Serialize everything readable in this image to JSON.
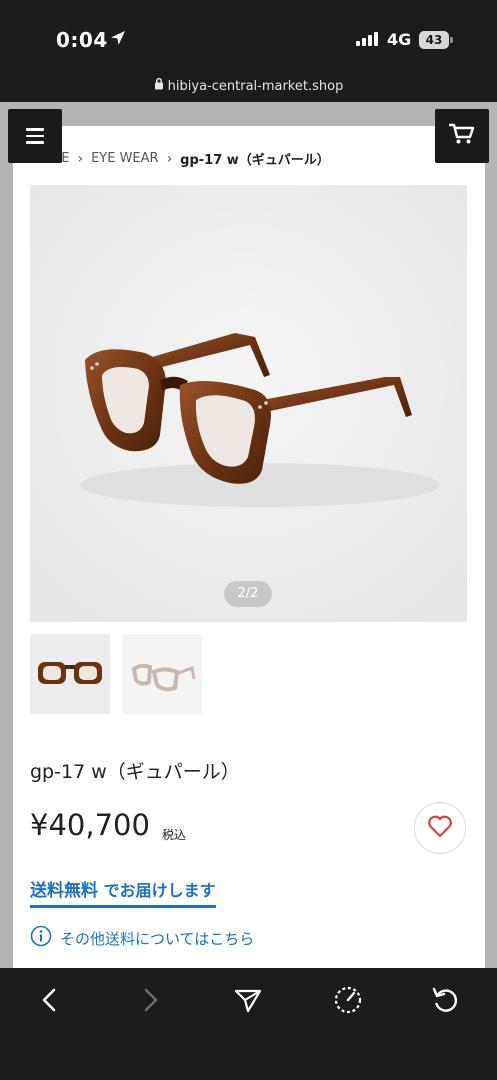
{
  "status_bar": {
    "time": "0:04",
    "network": "4G",
    "battery": "43"
  },
  "browser": {
    "url": "hibiya-central-market.shop"
  },
  "breadcrumb": {
    "items": [
      "HOME",
      "EYE WEAR",
      "gp-17 w（ギュパール）"
    ]
  },
  "gallery": {
    "pager": "2/2",
    "current_index": 2,
    "total": 2
  },
  "product": {
    "name": "gp-17 w（ギュパール）",
    "price": "¥40,700",
    "tax_label": "税込",
    "shipping_highlight": "送料無料",
    "shipping_rest": " でお届けします",
    "shipping_info_link": "その他送料についてはこちら"
  },
  "icons": {
    "menu": "hamburger-icon",
    "cart": "cart-icon",
    "favorite": "heart-icon",
    "info": "info-icon",
    "back": "back-icon",
    "forward": "forward-icon",
    "share": "share-icon",
    "performance": "gauge-icon",
    "reload": "reload-icon",
    "location": "location-arrow-icon",
    "lock": "lock-icon"
  },
  "colors": {
    "accent": "#1a73c8",
    "heart": "#d9404a",
    "frame_brown": "#7a3d1c"
  }
}
